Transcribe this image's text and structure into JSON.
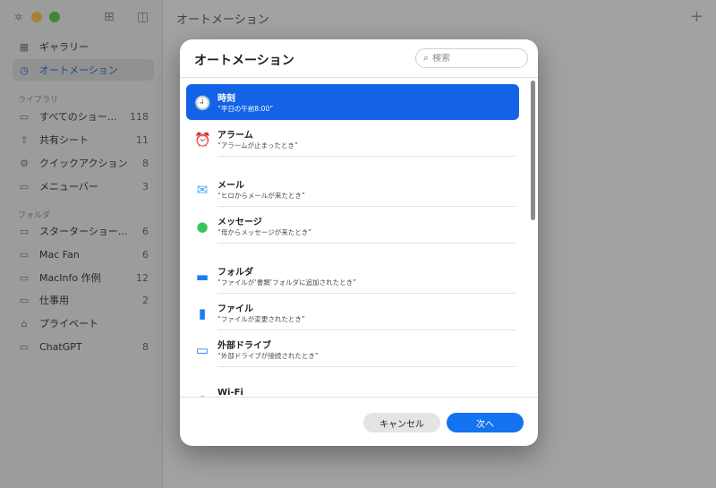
{
  "window": {
    "title": "オートメーション",
    "add_glyph": "+"
  },
  "sidebar": {
    "top_items": [
      {
        "label": "ギャラリー",
        "icon": "grid-icon",
        "glyph": "▦"
      },
      {
        "label": "オートメーション",
        "icon": "clock-icon",
        "glyph": "◷",
        "active": true
      }
    ],
    "library_header": "ライブラリ",
    "library_items": [
      {
        "label": "すべてのショートカ…",
        "count": "118",
        "glyph": "▭"
      },
      {
        "label": "共有シート",
        "count": "11",
        "glyph": "⇧"
      },
      {
        "label": "クイックアクション",
        "count": "8",
        "glyph": "⚙"
      },
      {
        "label": "メニューバー",
        "count": "3",
        "glyph": "▭"
      }
    ],
    "folder_header": "フォルダ",
    "folder_items": [
      {
        "label": "スターターショートカ…",
        "count": "6",
        "glyph": "▭"
      },
      {
        "label": "Mac Fan",
        "count": "6",
        "glyph": "▭"
      },
      {
        "label": "MacInfo 作例",
        "count": "12",
        "glyph": "▭"
      },
      {
        "label": "仕事用",
        "count": "2",
        "glyph": "▭"
      },
      {
        "label": "プライベート",
        "count": "",
        "glyph": "⌂"
      },
      {
        "label": "ChatGPT",
        "count": "8",
        "glyph": "▭"
      }
    ]
  },
  "modal": {
    "title": "オートメーション",
    "search_placeholder": "検索",
    "rows": [
      {
        "title": "時刻",
        "subtitle": "“平日の午前8:00”",
        "icon": "clock-icon",
        "glyph": "🕘",
        "selected": true
      },
      {
        "title": "アラーム",
        "subtitle": "“アラームが止まったとき”",
        "icon": "alarm-icon",
        "glyph": "⏰"
      },
      {
        "title": "メール",
        "subtitle": "“ヒロからメールが来たとき”",
        "icon": "mail-icon",
        "glyph": "✉"
      },
      {
        "title": "メッセージ",
        "subtitle": "“母からメッセージが来たとき”",
        "icon": "message-icon",
        "glyph": "●"
      },
      {
        "title": "フォルダ",
        "subtitle": "“ファイルが‘書類’フォルダに追加されたとき”",
        "icon": "folder-icon",
        "glyph": "▬"
      },
      {
        "title": "ファイル",
        "subtitle": "“ファイルが変更されたとき”",
        "icon": "file-icon",
        "glyph": "▮"
      },
      {
        "title": "外部ドライブ",
        "subtitle": "“外部ドライブが接続されたとき”",
        "icon": "drive-icon",
        "glyph": "▭"
      },
      {
        "title": "Wi-Fi",
        "subtitle": "",
        "icon": "wifi-icon",
        "glyph": "◠"
      }
    ],
    "cancel_label": "キャンセル",
    "next_label": "次へ"
  },
  "colors": {
    "accent": "#1463e6",
    "next_button": "#1473f0",
    "alarm_orange": "#f2a33a",
    "message_green": "#34c759",
    "mail_blue": "#4aa3f0"
  }
}
